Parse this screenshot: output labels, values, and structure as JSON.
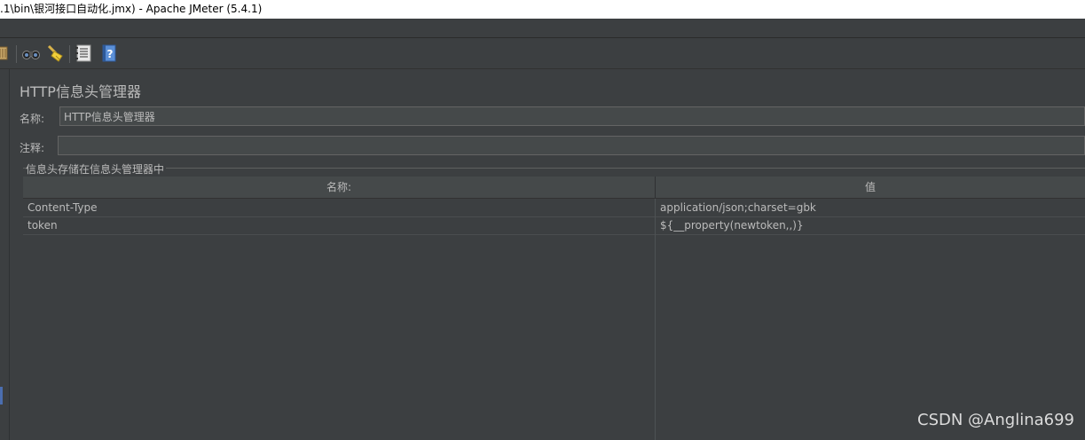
{
  "window": {
    "title": ".1\\bin\\银河接口自动化.jmx) - Apache JMeter (5.4.1)"
  },
  "toolbar": {
    "icons": [
      "broom-icon",
      "binoculars-icon",
      "clear-all-broom-icon",
      "function-list-icon",
      "help-icon"
    ]
  },
  "panel": {
    "title": "HTTP信息头管理器",
    "name_label": "名称:",
    "name_value": "HTTP信息头管理器",
    "comment_label": "注释:",
    "comment_value": "",
    "group_title": "信息头存储在信息头管理器中"
  },
  "table": {
    "columns": [
      "名称:",
      "值"
    ],
    "rows": [
      {
        "name": "Content-Type",
        "value": "application/json;charset=gbk"
      },
      {
        "name": "token",
        "value": "${__property(newtoken,,)}"
      }
    ]
  },
  "watermark": "CSDN @Anglina699",
  "colors": {
    "background": "#3c3f41",
    "text": "#bbbbbb",
    "input_bg": "#45494a",
    "accent": "#4b6eaf"
  }
}
